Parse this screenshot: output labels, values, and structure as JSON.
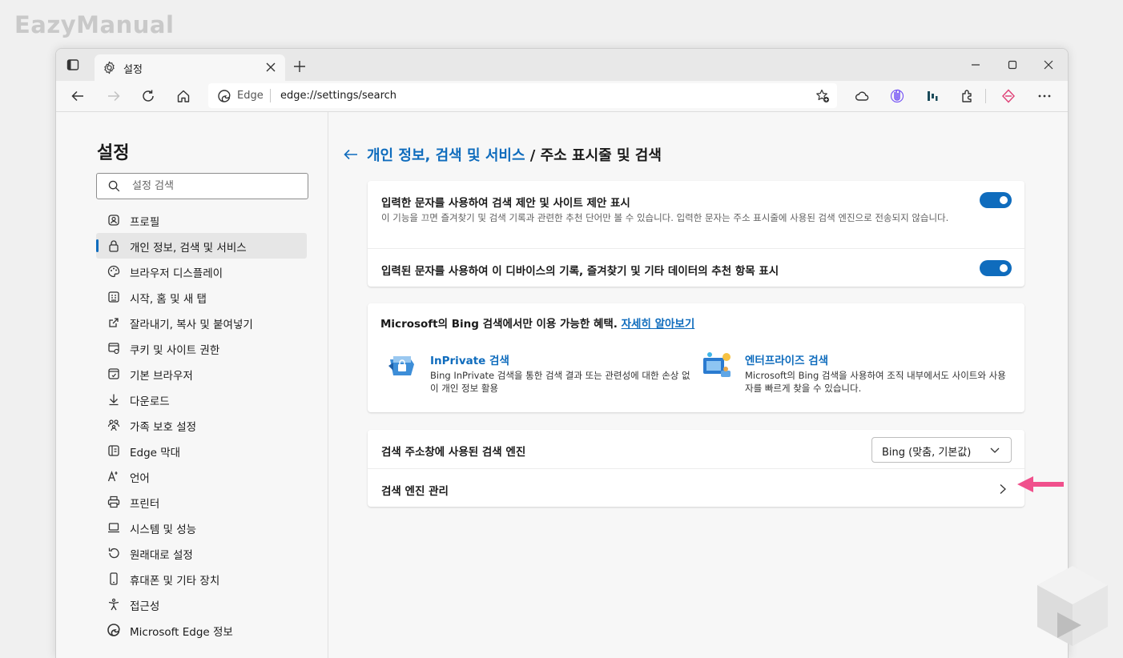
{
  "watermark": "EazyManual",
  "tab": {
    "title": "설정"
  },
  "address": {
    "edge_label": "Edge",
    "url": "edge://settings/search"
  },
  "sidebar": {
    "title": "설정",
    "search_placeholder": "설정 검색",
    "items": [
      {
        "label": "프로필",
        "icon": "profile-icon"
      },
      {
        "label": "개인 정보, 검색 및 서비스",
        "icon": "lock-icon",
        "active": true
      },
      {
        "label": "브라우저 디스플레이",
        "icon": "palette-icon"
      },
      {
        "label": "시작, 홈 및 새 탭",
        "icon": "home-grid-icon"
      },
      {
        "label": "잘라내기, 복사 및 붙여넣기",
        "icon": "share-icon"
      },
      {
        "label": "쿠키 및 사이트 권한",
        "icon": "cookie-icon"
      },
      {
        "label": "기본 브라우저",
        "icon": "browser-icon"
      },
      {
        "label": "다운로드",
        "icon": "download-icon"
      },
      {
        "label": "가족 보호 설정",
        "icon": "family-icon"
      },
      {
        "label": "Edge 막대",
        "icon": "bar-icon"
      },
      {
        "label": "언어",
        "icon": "language-icon"
      },
      {
        "label": "프린터",
        "icon": "printer-icon"
      },
      {
        "label": "시스템 및 성능",
        "icon": "laptop-icon"
      },
      {
        "label": "원래대로 설정",
        "icon": "reset-icon"
      },
      {
        "label": "휴대폰 및 기타 장치",
        "icon": "phone-icon"
      },
      {
        "label": "접근성",
        "icon": "accessibility-icon"
      },
      {
        "label": "Microsoft Edge 정보",
        "icon": "edge-logo-icon"
      }
    ]
  },
  "main": {
    "breadcrumb_parent": "개인 정보, 검색 및 서비스",
    "breadcrumb_sep": " / ",
    "breadcrumb_current": "주소 표시줄 및 검색",
    "suggest": {
      "title": "입력한 문자를 사용하여 검색 제안 및 사이트 제안 표시",
      "desc": "이 기능을 끄면 즐겨찾기 및 검색 기록과 관련한 추천 단어만 볼 수 있습니다. 입력한 문자는 주소 표시줄에 사용된 검색 엔진으로 전송되지 않습니다.",
      "enabled": true
    },
    "history": {
      "title": "입력된 문자를 사용하여 이 디바이스의 기록, 즐겨찾기 및 기타 데이터의 추천 항목 표시",
      "enabled": true
    },
    "bing": {
      "heading": "Microsoft의 Bing 검색에서만 이용 가능한 혜택. ",
      "learn_more": "자세히 알아보기",
      "inprivate": {
        "title": "InPrivate 검색",
        "desc": "Bing InPrivate 검색을 통한 검색 결과 또는 관련성에 대한 손상 없이 개인 정보 활용"
      },
      "enterprise": {
        "title": "엔터프라이즈 검색",
        "desc": "Microsoft의 Bing 검색을 사용하여 조직 내부에서도 사이트와 사용자를 빠르게 찾을 수 있습니다."
      }
    },
    "engine": {
      "label": "검색 주소창에 사용된 검색 엔진",
      "selected": "Bing (맞춤, 기본값)"
    },
    "manage": {
      "label": "검색 엔진 관리"
    }
  },
  "colors": {
    "accent": "#0f6cbd",
    "arrow": "#f0508c"
  }
}
